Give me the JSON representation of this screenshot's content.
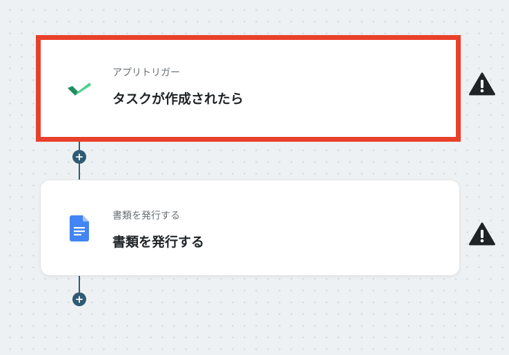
{
  "flow": {
    "steps": [
      {
        "sub_label": "アプリトリガー",
        "title": "タスクが作成されたら",
        "icon": "check-logo-icon",
        "warning_icon": "warning-icon"
      },
      {
        "sub_label": "書類を発行する",
        "title": "書類を発行する",
        "icon": "google-docs-icon",
        "warning_icon": "warning-icon"
      }
    ],
    "add_step_label": "+"
  },
  "colors": {
    "highlight": "#e8402a",
    "connector": "#2f5b72",
    "check_dark": "#1f8f5f",
    "check_light": "#4fd18b",
    "docs_blue": "#4285f4"
  }
}
